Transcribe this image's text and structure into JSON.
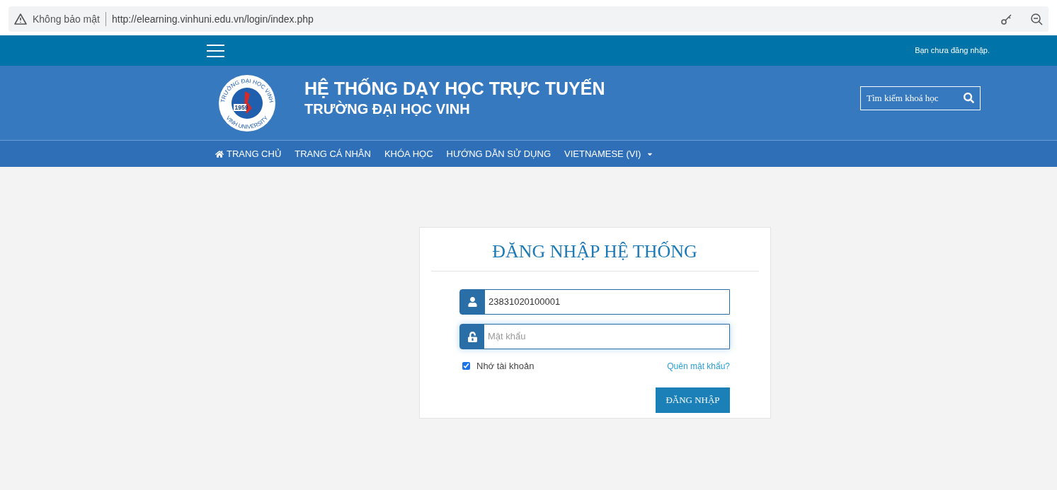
{
  "browser": {
    "security_label": "Không bảo mật",
    "url": "http://elearning.vinhuni.edu.vn/login/index.php"
  },
  "top_bar": {
    "login_status": "Bạn chưa đăng nhập."
  },
  "header": {
    "logo": {
      "top_text": "TRƯỜNG ĐẠI HỌC VINH",
      "year": "1959",
      "bottom_text": "VINH UNIVERSITY"
    },
    "title": "HỆ THỐNG DẠY HỌC TRỰC TUYẾN",
    "subtitle": "TRƯỜNG ĐẠI HỌC VINH",
    "search": {
      "placeholder": "Tìm kiếm khoá học"
    }
  },
  "nav": [
    {
      "label": "TRANG CHỦ",
      "kind": "home"
    },
    {
      "label": "TRANG CÁ NHÂN",
      "kind": "link"
    },
    {
      "label": "KHÓA HỌC",
      "kind": "link"
    },
    {
      "label": "HƯỚNG DẪN SỬ DỤNG",
      "kind": "link"
    },
    {
      "label": "VIETNAMESE (VI)",
      "kind": "dropdown"
    }
  ],
  "login": {
    "title": "ĐĂNG NHẬP HỆ THỐNG",
    "username": {
      "value": "23831020100001"
    },
    "password": {
      "placeholder": "Mật khẩu"
    },
    "remember": {
      "label": "Nhớ tài khoản",
      "checked": true
    },
    "forgot_link": "Quên mật khẩu?",
    "submit": "ĐĂNG NHẬP"
  }
}
